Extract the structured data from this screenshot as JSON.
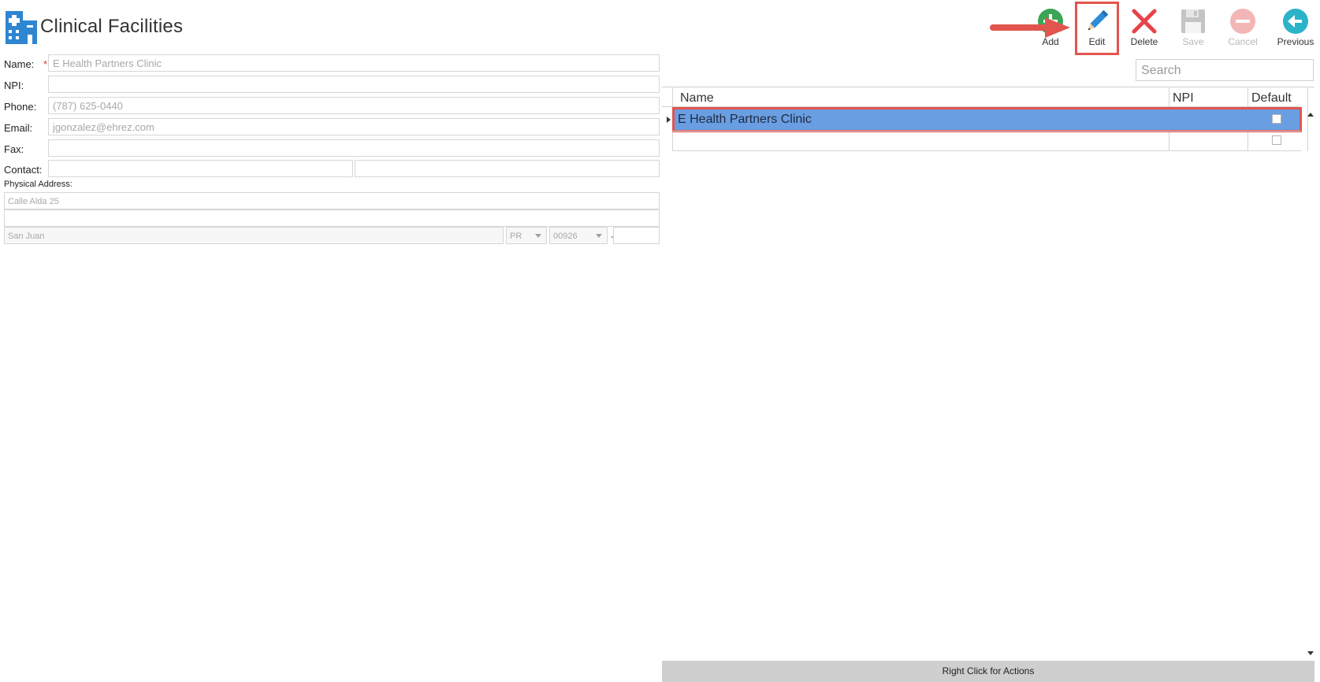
{
  "header": {
    "title": "Clinical Facilities",
    "icon": "hospital-building-icon"
  },
  "form": {
    "name_label": "Name:",
    "required_mark": "*",
    "name_value": "E Health Partners Clinic",
    "npi_label": "NPI:",
    "npi_value": "",
    "phone_label": "Phone:",
    "phone_value": "(787) 625-0440",
    "email_label": "Email:",
    "email_value": "jgonzalez@ehrez.com",
    "fax_label": "Fax:",
    "fax_value": "",
    "contact_label": "Contact:",
    "contact_first": "",
    "contact_last": "",
    "physical_address_label": "Physical Address:",
    "address_line1": "Calle Alda 25",
    "address_line2": "",
    "city": "San Juan",
    "state": "PR",
    "zip": "00926",
    "zip_separator": "-",
    "zip_ext": ""
  },
  "toolbar": {
    "add": "Add",
    "edit": "Edit",
    "delete": "Delete",
    "save": "Save",
    "cancel": "Cancel",
    "previous": "Previous"
  },
  "search": {
    "placeholder": "Search"
  },
  "grid": {
    "columns": [
      "Name",
      "NPI",
      "Default"
    ],
    "rows": [
      {
        "name": "E Health Partners Clinic",
        "npi": "",
        "default": false,
        "selected": true
      },
      {
        "name": "",
        "npi": "",
        "default": false,
        "selected": false
      }
    ]
  },
  "status_bar": {
    "text": "Right Click for Actions"
  },
  "colors": {
    "selected_row": "#6a9ee2",
    "highlight_border": "#e2544e",
    "add_green": "#3aa655",
    "edit_blue": "#2e8bd6",
    "delete_red": "#e8434a",
    "previous_teal": "#2bb3c8"
  }
}
